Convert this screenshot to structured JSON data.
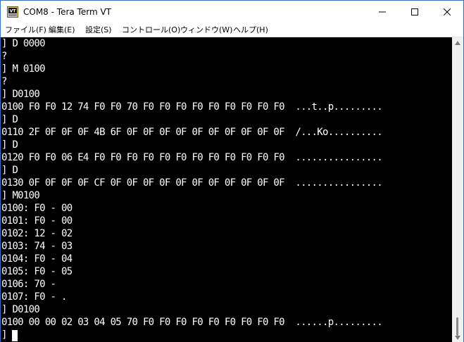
{
  "window": {
    "title": "COM8 - Tera Term VT",
    "icon_label": "VT"
  },
  "menu": [
    {
      "label": "ファイル(F)"
    },
    {
      "label": "編集(E)"
    },
    {
      "label": "設定(S)"
    },
    {
      "label": "コントロール(O)"
    },
    {
      "label": "ウィンドウ(W)"
    },
    {
      "label": "ヘルプ(H)"
    }
  ],
  "terminal": {
    "lines": [
      "] D 0000",
      "?",
      "] M 0100",
      "?",
      "] D0100",
      "0100 F0 F0 12 74 F0 F0 70 F0 F0 F0 F0 F0 F0 F0 F0 F0  ...t..p.........",
      "] D",
      "0110 2F 0F 0F 0F 4B 6F 0F 0F 0F 0F 0F 0F 0F 0F 0F 0F  /...Ko..........",
      "] D",
      "0120 F0 F0 06 E4 F0 F0 F0 F0 F0 F0 F0 F0 F0 F0 F0 F0  ................",
      "] D",
      "0130 0F 0F 0F 0F CF 0F 0F 0F 0F 0F 0F 0F 0F 0F 0F 0F  ................",
      "] M0100",
      "0100: F0 - 00",
      "0101: F0 - 00",
      "0102: 12 - 02",
      "0103: 74 - 03",
      "0104: F0 - 04",
      "0105: F0 - 05",
      "0106: 70 -",
      "0107: F0 - .",
      "] D0100",
      "0100 00 00 02 03 04 05 70 F0 F0 F0 F0 F0 F0 F0 F0 F0  ......p.........",
      "]"
    ],
    "background": "#000000",
    "foreground": "#ffffff"
  },
  "icons": {
    "app": "teraterm-vt-icon",
    "minimize": "minimize-icon",
    "maximize": "maximize-icon",
    "close": "close-icon",
    "scroll_up": "chevron-up-icon",
    "scroll_down": "chevron-down-icon"
  }
}
